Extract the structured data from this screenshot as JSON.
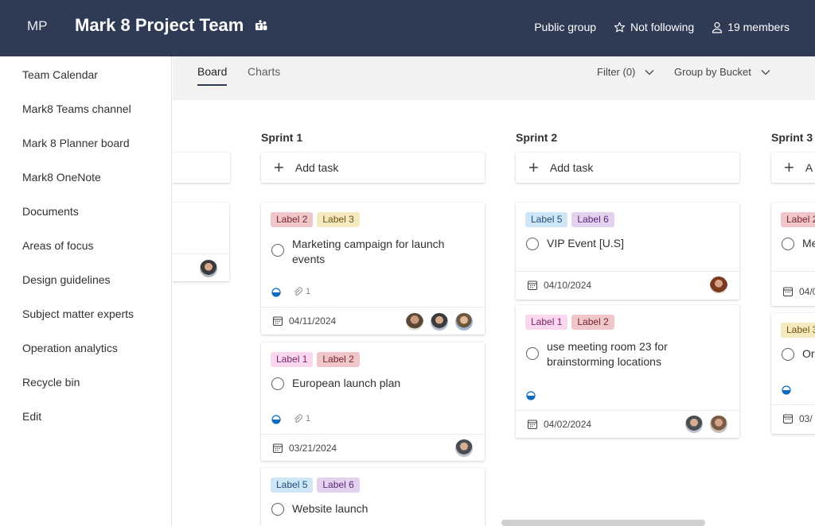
{
  "header": {
    "initials": "MP",
    "title": "Mark 8 Project Team",
    "visibility": "Public group",
    "follow": "Not following",
    "members": "19 members",
    "background_color": "#2f3a55"
  },
  "sidebar": {
    "items": [
      {
        "label": "Team Calendar"
      },
      {
        "label": "Mark8 Teams channel"
      },
      {
        "label": "Mark 8 Planner board"
      },
      {
        "label": "Mark8 OneNote"
      },
      {
        "label": "Documents"
      },
      {
        "label": "Areas of focus"
      },
      {
        "label": "Design guidelines"
      },
      {
        "label": "Subject matter experts"
      },
      {
        "label": "Operation analytics"
      },
      {
        "label": "Recycle bin"
      },
      {
        "label": "Edit"
      }
    ]
  },
  "toolbar": {
    "tabs": [
      {
        "label": "Board",
        "active": true
      },
      {
        "label": "Charts",
        "active": false
      }
    ],
    "filter": "Filter (0)",
    "group_by": "Group by Bucket"
  },
  "board": {
    "add_task_label": "Add task",
    "buckets": [
      {
        "name": "Sprint 1",
        "tasks": [
          {
            "labels": [
              "Label 2",
              "Label 3"
            ],
            "title": "Marketing campaign for launch events",
            "progress": "in progress",
            "attachments": "1",
            "date": "04/11/2024",
            "assignees": 3
          },
          {
            "labels": [
              "Label 1",
              "Label 2"
            ],
            "title": "European launch plan",
            "progress": "in progress",
            "attachments": "1",
            "date": "03/21/2024",
            "assignees": 1
          },
          {
            "labels": [
              "Label 5",
              "Label 6"
            ],
            "title": "Website launch"
          }
        ]
      },
      {
        "name": "Sprint 2",
        "tasks": [
          {
            "labels": [
              "Label 5",
              "Label 6"
            ],
            "title": "VIP Event [U.S]",
            "date": "04/10/2024",
            "assignees": 1
          },
          {
            "labels": [
              "Label 1",
              "Label 2"
            ],
            "title": "use meeting room 23 for brainstorming locations",
            "progress": "in progress",
            "date": "04/02/2024",
            "assignees": 2
          }
        ]
      },
      {
        "name": "Sprint 3",
        "add_task_visible": "A",
        "tasks": [
          {
            "labels": [
              "Label 2"
            ],
            "title": "Me",
            "date": "04/0"
          },
          {
            "labels": [
              "Label 3"
            ],
            "title": "Or",
            "date": "03/"
          }
        ]
      }
    ]
  }
}
